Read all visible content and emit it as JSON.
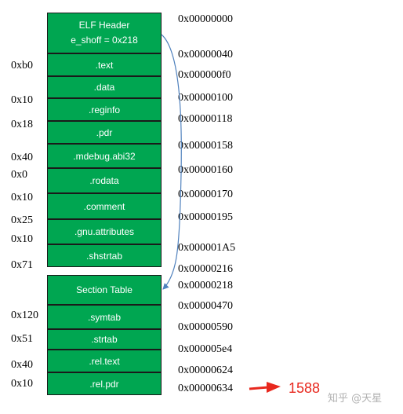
{
  "elf_header": {
    "line1": "ELF Header",
    "line2": "e_shoff = 0x218"
  },
  "sections": [
    ".text",
    ".data",
    ".reginfo",
    ".pdr",
    ".mdebug.abi32",
    ".rodata",
    ".comment",
    ".gnu.attributes",
    ".shstrtab"
  ],
  "section_table": {
    "title": "Section Table",
    "entries": [
      ".symtab",
      ".strtab",
      ".rel.text",
      ".rel.pdr"
    ]
  },
  "sizes": [
    "0xb0",
    "0x10",
    "0x18",
    "0x40",
    "0x0",
    "0x10",
    "0x25",
    "0x10",
    "0x71",
    "0x120",
    "0x51",
    "0x40",
    "0x10"
  ],
  "offsets": [
    "0x00000000",
    "0x00000040",
    "0x000000f0",
    "0x00000100",
    "0x00000118",
    "0x00000158",
    "0x00000160",
    "0x00000170",
    "0x00000195",
    "0x000001A5",
    "0x00000216",
    "0x00000218",
    "0x00000470",
    "0x00000590",
    "0x000005e4",
    "0x00000624",
    "0x00000634"
  ],
  "result": "1588",
  "watermark": "知乎 @天星",
  "colors": {
    "block": "#00a651",
    "pointer_arrow": "#4f81bd",
    "result_arrow": "#e8281e"
  }
}
